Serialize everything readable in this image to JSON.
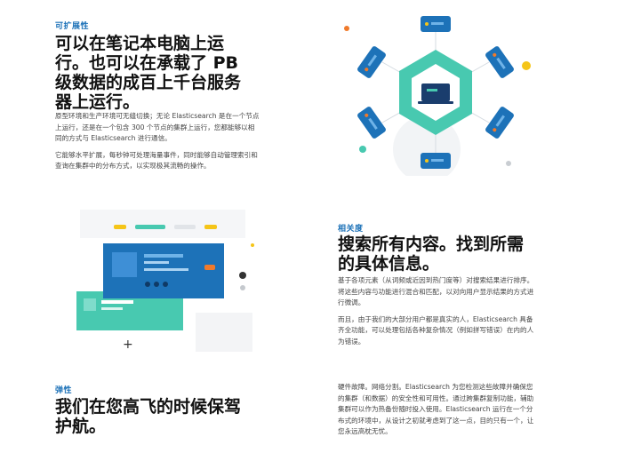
{
  "section1": {
    "eyebrow": "可扩展性",
    "heading": "可以在笔记本电脑上运行。也可以在承载了 PB 级数据的成百上千台服务器上运行。",
    "para1": "原型环境和生产环境可无缝切换；无论 Elasticsearch 是在一个节点上运行，还是在一个包含 300 个节点的集群上运行，您都能够以相同的方式与 Elasticsearch 进行通信。",
    "para2": "它能够水平扩展，每秒钟可处理海量事件，同时能够自动管理索引和查询在集群中的分布方式，以实现极其流畅的操作。"
  },
  "section2": {
    "eyebrow": "相关度",
    "heading": "搜索所有内容。找到所需的具体信息。",
    "para1": "基于各项元素（从词频或近因到热门度等）对搜索结果进行排序。将这些内容与功能进行混合和匹配，以对向用户显示结果的方式进行微调。",
    "para2": "而且，由于我们的大部分用户都是真实的人，Elasticsearch 具备齐全功能，可以处理包括各种复杂情况（例如拼写错误）在内的人为错误。"
  },
  "section3": {
    "eyebrow": "弹性",
    "heading": "我们在您高飞的时候保驾护航。",
    "para1": "硬件故障。网络分割。Elasticsearch 为您检测这些故障并确保您的集群（和数据）的安全性和可用性。通过跨集群复制功能，辅助集群可以作为热备份随时投入使用。Elasticsearch 运行在一个分布式的环境中，从设计之初就考虑到了这一点，目的只有一个，让您永远高枕无忧。"
  },
  "colors": {
    "accent_blue": "#1d72b8",
    "teal": "#48c9b0",
    "yellow": "#f5c518",
    "orange": "#f07a2b",
    "navy": "#1a3d6d"
  }
}
